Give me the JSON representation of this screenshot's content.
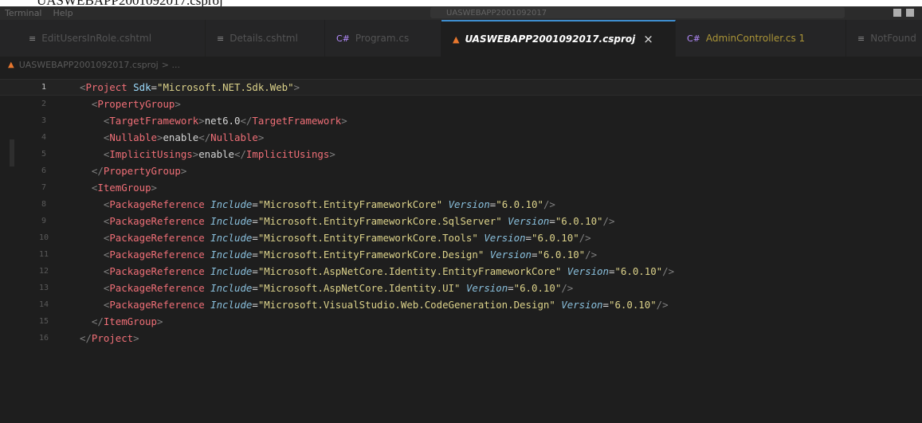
{
  "doc_caption": "UASWEBAPP2001092017.csproj",
  "titlebar": {
    "menu": [
      "Terminal",
      "Help"
    ],
    "search_text": "UASWEBAPP2001092017"
  },
  "tabs": [
    {
      "label": "EditUsersInRole.cshtml",
      "icon": "razor-file-icon",
      "state": "inactive"
    },
    {
      "label": "Details.cshtml",
      "icon": "razor-file-icon",
      "state": "inactive"
    },
    {
      "label": "Program.cs",
      "icon": "csharp-file-icon",
      "state": "inactive"
    },
    {
      "label": "UASWEBAPP2001092017.csproj",
      "icon": "project-file-icon",
      "state": "active",
      "close": "×"
    },
    {
      "label": "AdminController.cs 1",
      "icon": "csharp-file-icon",
      "state": "modified"
    },
    {
      "label": "NotFound",
      "icon": "razor-file-icon",
      "state": "inactive"
    }
  ],
  "breadcrumb": {
    "file": "UASWEBAPP2001092017.csproj",
    "rest": "> ..."
  },
  "editor": {
    "current_line": 1,
    "lines": [
      {
        "n": "1",
        "indent": "",
        "parts": [
          [
            "p",
            "<"
          ],
          [
            "t",
            "Project "
          ],
          [
            "a",
            "Sdk"
          ],
          [
            "eq",
            "="
          ],
          [
            "s",
            "\"Microsoft.NET.Sdk.Web\""
          ],
          [
            "p",
            ">"
          ]
        ]
      },
      {
        "n": "2",
        "indent": "  ",
        "parts": [
          [
            "p",
            "<"
          ],
          [
            "t",
            "PropertyGroup"
          ],
          [
            "p",
            ">"
          ]
        ]
      },
      {
        "n": "3",
        "indent": "    ",
        "parts": [
          [
            "p",
            "<"
          ],
          [
            "t",
            "TargetFramework"
          ],
          [
            "p",
            ">"
          ],
          [
            "txt",
            "net6.0"
          ],
          [
            "p",
            "</"
          ],
          [
            "t",
            "TargetFramework"
          ],
          [
            "p",
            ">"
          ]
        ]
      },
      {
        "n": "4",
        "indent": "    ",
        "parts": [
          [
            "p",
            "<"
          ],
          [
            "t",
            "Nullable"
          ],
          [
            "p",
            ">"
          ],
          [
            "txt",
            "enable"
          ],
          [
            "p",
            "</"
          ],
          [
            "t",
            "Nullable"
          ],
          [
            "p",
            ">"
          ]
        ]
      },
      {
        "n": "5",
        "indent": "    ",
        "parts": [
          [
            "p",
            "<"
          ],
          [
            "t",
            "ImplicitUsings"
          ],
          [
            "p",
            ">"
          ],
          [
            "txt",
            "enable"
          ],
          [
            "p",
            "</"
          ],
          [
            "t",
            "ImplicitUsings"
          ],
          [
            "p",
            ">"
          ]
        ]
      },
      {
        "n": "6",
        "indent": "  ",
        "parts": [
          [
            "p",
            "</"
          ],
          [
            "t",
            "PropertyGroup"
          ],
          [
            "p",
            ">"
          ]
        ]
      },
      {
        "n": "7",
        "indent": "  ",
        "parts": [
          [
            "p",
            "<"
          ],
          [
            "t",
            "ItemGroup"
          ],
          [
            "p",
            ">"
          ]
        ]
      },
      {
        "n": "8",
        "indent": "    ",
        "parts": [
          [
            "p",
            "<"
          ],
          [
            "t",
            "PackageReference "
          ],
          [
            "ai",
            "Include"
          ],
          [
            "eq",
            "="
          ],
          [
            "s",
            "\"Microsoft.EntityFrameworkCore\""
          ],
          [
            "txt",
            " "
          ],
          [
            "ai",
            "Version"
          ],
          [
            "eq",
            "="
          ],
          [
            "s",
            "\"6.0.10\""
          ],
          [
            "p",
            "/>"
          ]
        ]
      },
      {
        "n": "9",
        "indent": "    ",
        "parts": [
          [
            "p",
            "<"
          ],
          [
            "t",
            "PackageReference "
          ],
          [
            "ai",
            "Include"
          ],
          [
            "eq",
            "="
          ],
          [
            "s",
            "\"Microsoft.EntityFrameworkCore.SqlServer\""
          ],
          [
            "txt",
            " "
          ],
          [
            "ai",
            "Version"
          ],
          [
            "eq",
            "="
          ],
          [
            "s",
            "\"6.0.10\""
          ],
          [
            "p",
            "/>"
          ]
        ]
      },
      {
        "n": "10",
        "indent": "    ",
        "parts": [
          [
            "p",
            "<"
          ],
          [
            "t",
            "PackageReference "
          ],
          [
            "ai",
            "Include"
          ],
          [
            "eq",
            "="
          ],
          [
            "s",
            "\"Microsoft.EntityFrameworkCore.Tools\""
          ],
          [
            "txt",
            " "
          ],
          [
            "ai",
            "Version"
          ],
          [
            "eq",
            "="
          ],
          [
            "s",
            "\"6.0.10\""
          ],
          [
            "p",
            "/>"
          ]
        ]
      },
      {
        "n": "11",
        "indent": "    ",
        "parts": [
          [
            "p",
            "<"
          ],
          [
            "t",
            "PackageReference "
          ],
          [
            "ai",
            "Include"
          ],
          [
            "eq",
            "="
          ],
          [
            "s",
            "\"Microsoft.EntityFrameworkCore.Design\""
          ],
          [
            "txt",
            " "
          ],
          [
            "ai",
            "Version"
          ],
          [
            "eq",
            "="
          ],
          [
            "s",
            "\"6.0.10\""
          ],
          [
            "p",
            "/>"
          ]
        ]
      },
      {
        "n": "12",
        "indent": "    ",
        "parts": [
          [
            "p",
            "<"
          ],
          [
            "t",
            "PackageReference "
          ],
          [
            "ai",
            "Include"
          ],
          [
            "eq",
            "="
          ],
          [
            "s",
            "\"Microsoft.AspNetCore.Identity.EntityFrameworkCore\""
          ],
          [
            "txt",
            " "
          ],
          [
            "ai",
            "Version"
          ],
          [
            "eq",
            "="
          ],
          [
            "s",
            "\"6.0.10\""
          ],
          [
            "p",
            "/>"
          ]
        ]
      },
      {
        "n": "13",
        "indent": "    ",
        "parts": [
          [
            "p",
            "<"
          ],
          [
            "t",
            "PackageReference "
          ],
          [
            "ai",
            "Include"
          ],
          [
            "eq",
            "="
          ],
          [
            "s",
            "\"Microsoft.AspNetCore.Identity.UI\""
          ],
          [
            "txt",
            " "
          ],
          [
            "ai",
            "Version"
          ],
          [
            "eq",
            "="
          ],
          [
            "s",
            "\"6.0.10\""
          ],
          [
            "p",
            "/>"
          ]
        ]
      },
      {
        "n": "14",
        "indent": "    ",
        "parts": [
          [
            "p",
            "<"
          ],
          [
            "t",
            "PackageReference "
          ],
          [
            "ai",
            "Include"
          ],
          [
            "eq",
            "="
          ],
          [
            "s",
            "\"Microsoft.VisualStudio.Web.CodeGeneration.Design\""
          ],
          [
            "txt",
            " "
          ],
          [
            "ai",
            "Version"
          ],
          [
            "eq",
            "="
          ],
          [
            "s",
            "\"6.0.10\""
          ],
          [
            "p",
            "/>"
          ]
        ]
      },
      {
        "n": "15",
        "indent": "  ",
        "parts": [
          [
            "p",
            "</"
          ],
          [
            "t",
            "ItemGroup"
          ],
          [
            "p",
            ">"
          ]
        ]
      },
      {
        "n": "16",
        "indent": "",
        "parts": [
          [
            "p",
            "</"
          ],
          [
            "t",
            "Project"
          ],
          [
            "p",
            ">"
          ]
        ]
      }
    ]
  },
  "colors": {
    "background": "#1e1e1e",
    "tag": "#f06f77",
    "string": "#dcd28a",
    "attribute": "#9cdcfe",
    "active_tab_accent": "#3e8ed0",
    "modified_tab": "#d7ba3d"
  }
}
